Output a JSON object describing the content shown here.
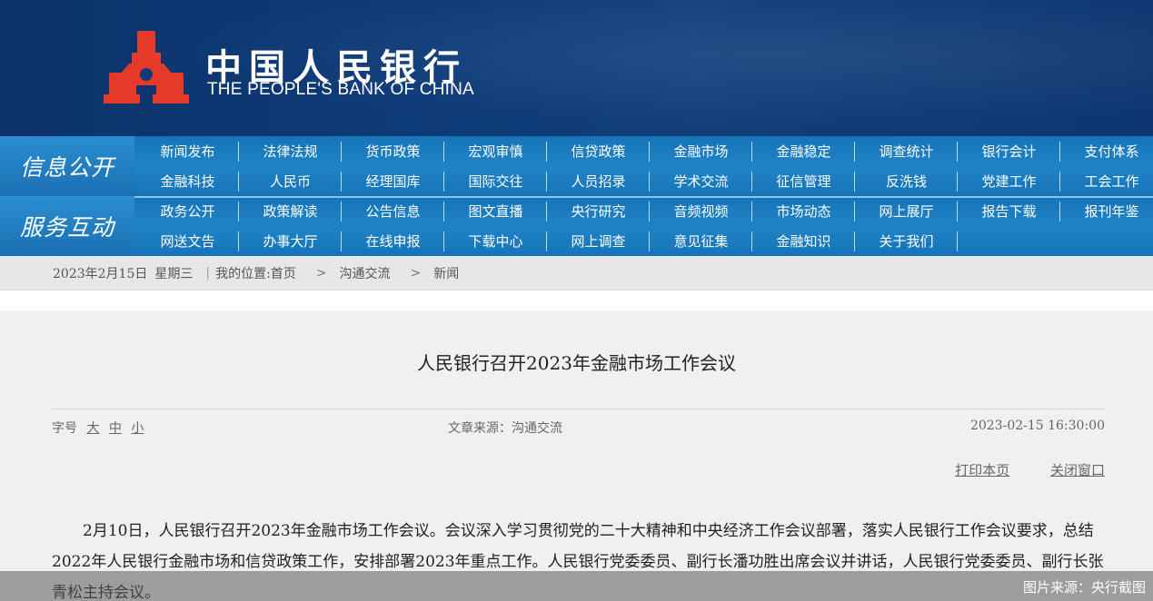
{
  "header": {
    "bank_name_cn": "中国人民银行",
    "bank_name_en": "THE PEOPLE'S BANK OF CHINA",
    "emblem_icon": "pboc-emblem-icon",
    "emblem_color": "#e02020"
  },
  "nav": {
    "info": {
      "label": "信息公开",
      "row1": [
        "新闻发布",
        "法律法规",
        "货币政策",
        "宏观审慎",
        "信贷政策",
        "金融市场",
        "金融稳定",
        "调查统计",
        "银行会计",
        "支付体系"
      ],
      "row2": [
        "金融科技",
        "人民币",
        "经理国库",
        "国际交往",
        "人员招录",
        "学术交流",
        "征信管理",
        "反洗钱",
        "党建工作",
        "工会工作"
      ]
    },
    "service": {
      "label": "服务互动",
      "row1": [
        "政务公开",
        "政策解读",
        "公告信息",
        "图文直播",
        "央行研究",
        "音频视频",
        "市场动态",
        "网上展厅",
        "报告下载",
        "报刊年鉴"
      ],
      "row2": [
        "网送文告",
        "办事大厅",
        "在线申报",
        "下载中心",
        "网上调查",
        "意见征集",
        "金融知识",
        "关于我们"
      ]
    }
  },
  "breadcrumb": {
    "date": "2023年2月15日",
    "weekday": "星期三",
    "separator": "|",
    "location_label": "我的位置:",
    "items": [
      "首页",
      "沟通交流",
      "新闻"
    ],
    "arrow": ">"
  },
  "article": {
    "title": "人民银行召开2023年金融市场工作会议",
    "font_size_label": "字号",
    "font_sizes": [
      "大",
      "中",
      "小"
    ],
    "source": "文章来源：沟通交流",
    "datetime": "2023-02-15 16:30:00",
    "print_label": "打印本页",
    "close_label": "关闭窗口",
    "body": "2月10日，人民银行召开2023年金融市场工作会议。会议深入学习贯彻党的二十大精神和中央经济工作会议部署，落实人民银行工作会议要求，总结2022年人民银行金融市场和信贷政策工作，安排部署2023年重点工作。人民银行党委委员、副行长潘功胜出席会议并讲话，人民银行党委委员、副行长张青松主持会议。"
  },
  "caption": "图片来源：央行截图"
}
